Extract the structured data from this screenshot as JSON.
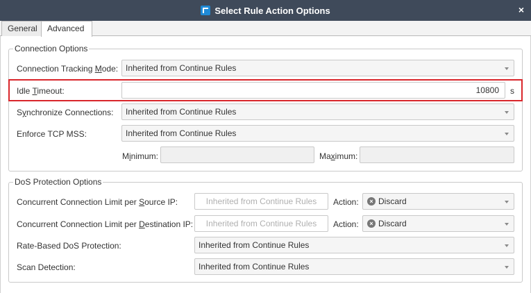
{
  "window": {
    "title": "Select Rule Action Options",
    "close_glyph": "×"
  },
  "tabs": [
    {
      "label": "General",
      "active": false
    },
    {
      "label": "Advanced",
      "active": true
    }
  ],
  "connection_options": {
    "legend": "Connection Options",
    "tracking_mode": {
      "label_pre": "Connection Tracking ",
      "label_u": "M",
      "label_post": "ode:",
      "value": "Inherited from Continue Rules"
    },
    "idle_timeout": {
      "label_pre": "Idle ",
      "label_u": "T",
      "label_post": "imeout:",
      "value": "10800",
      "unit": "s"
    },
    "synchronize": {
      "label_pre": "S",
      "label_u": "y",
      "label_post": "nchronize Connections:",
      "value": "Inherited from Continue Rules"
    },
    "tcp_mss": {
      "label": "Enforce TCP MSS:",
      "value": "Inherited from Continue Rules",
      "minimum": {
        "label_pre": "M",
        "label_u": "i",
        "label_post": "nimum:",
        "value": ""
      },
      "maximum": {
        "label_pre": "Ma",
        "label_u": "x",
        "label_post": "imum:",
        "value": ""
      }
    }
  },
  "dos_options": {
    "legend": "DoS Protection Options",
    "source_limit": {
      "label_pre": "Concurrent Connection Limit per ",
      "label_u": "S",
      "label_post": "ource IP:",
      "placeholder": "Inherited from Continue Rules",
      "action_label": "Action:",
      "action_value": "Discard"
    },
    "dest_limit": {
      "label_pre": "Concurrent Connection Limit per ",
      "label_u": "D",
      "label_post": "estination IP:",
      "placeholder": "Inherited from Continue Rules",
      "action_label": "Action:",
      "action_value": "Discard"
    },
    "rate_based": {
      "label": "Rate-Based DoS Protection:",
      "value": "Inherited from Continue Rules"
    },
    "scan_detection": {
      "label": "Scan Detection:",
      "value": "Inherited from Continue Rules"
    }
  },
  "icons": {
    "app": "app-logo-icon",
    "close": "close-icon",
    "discard": "discard-icon",
    "dropdown": "chevron-down-icon"
  },
  "colors": {
    "titlebar": "#3f4a5a",
    "highlight": "#d9262b",
    "accent": "#1f8ad6"
  }
}
